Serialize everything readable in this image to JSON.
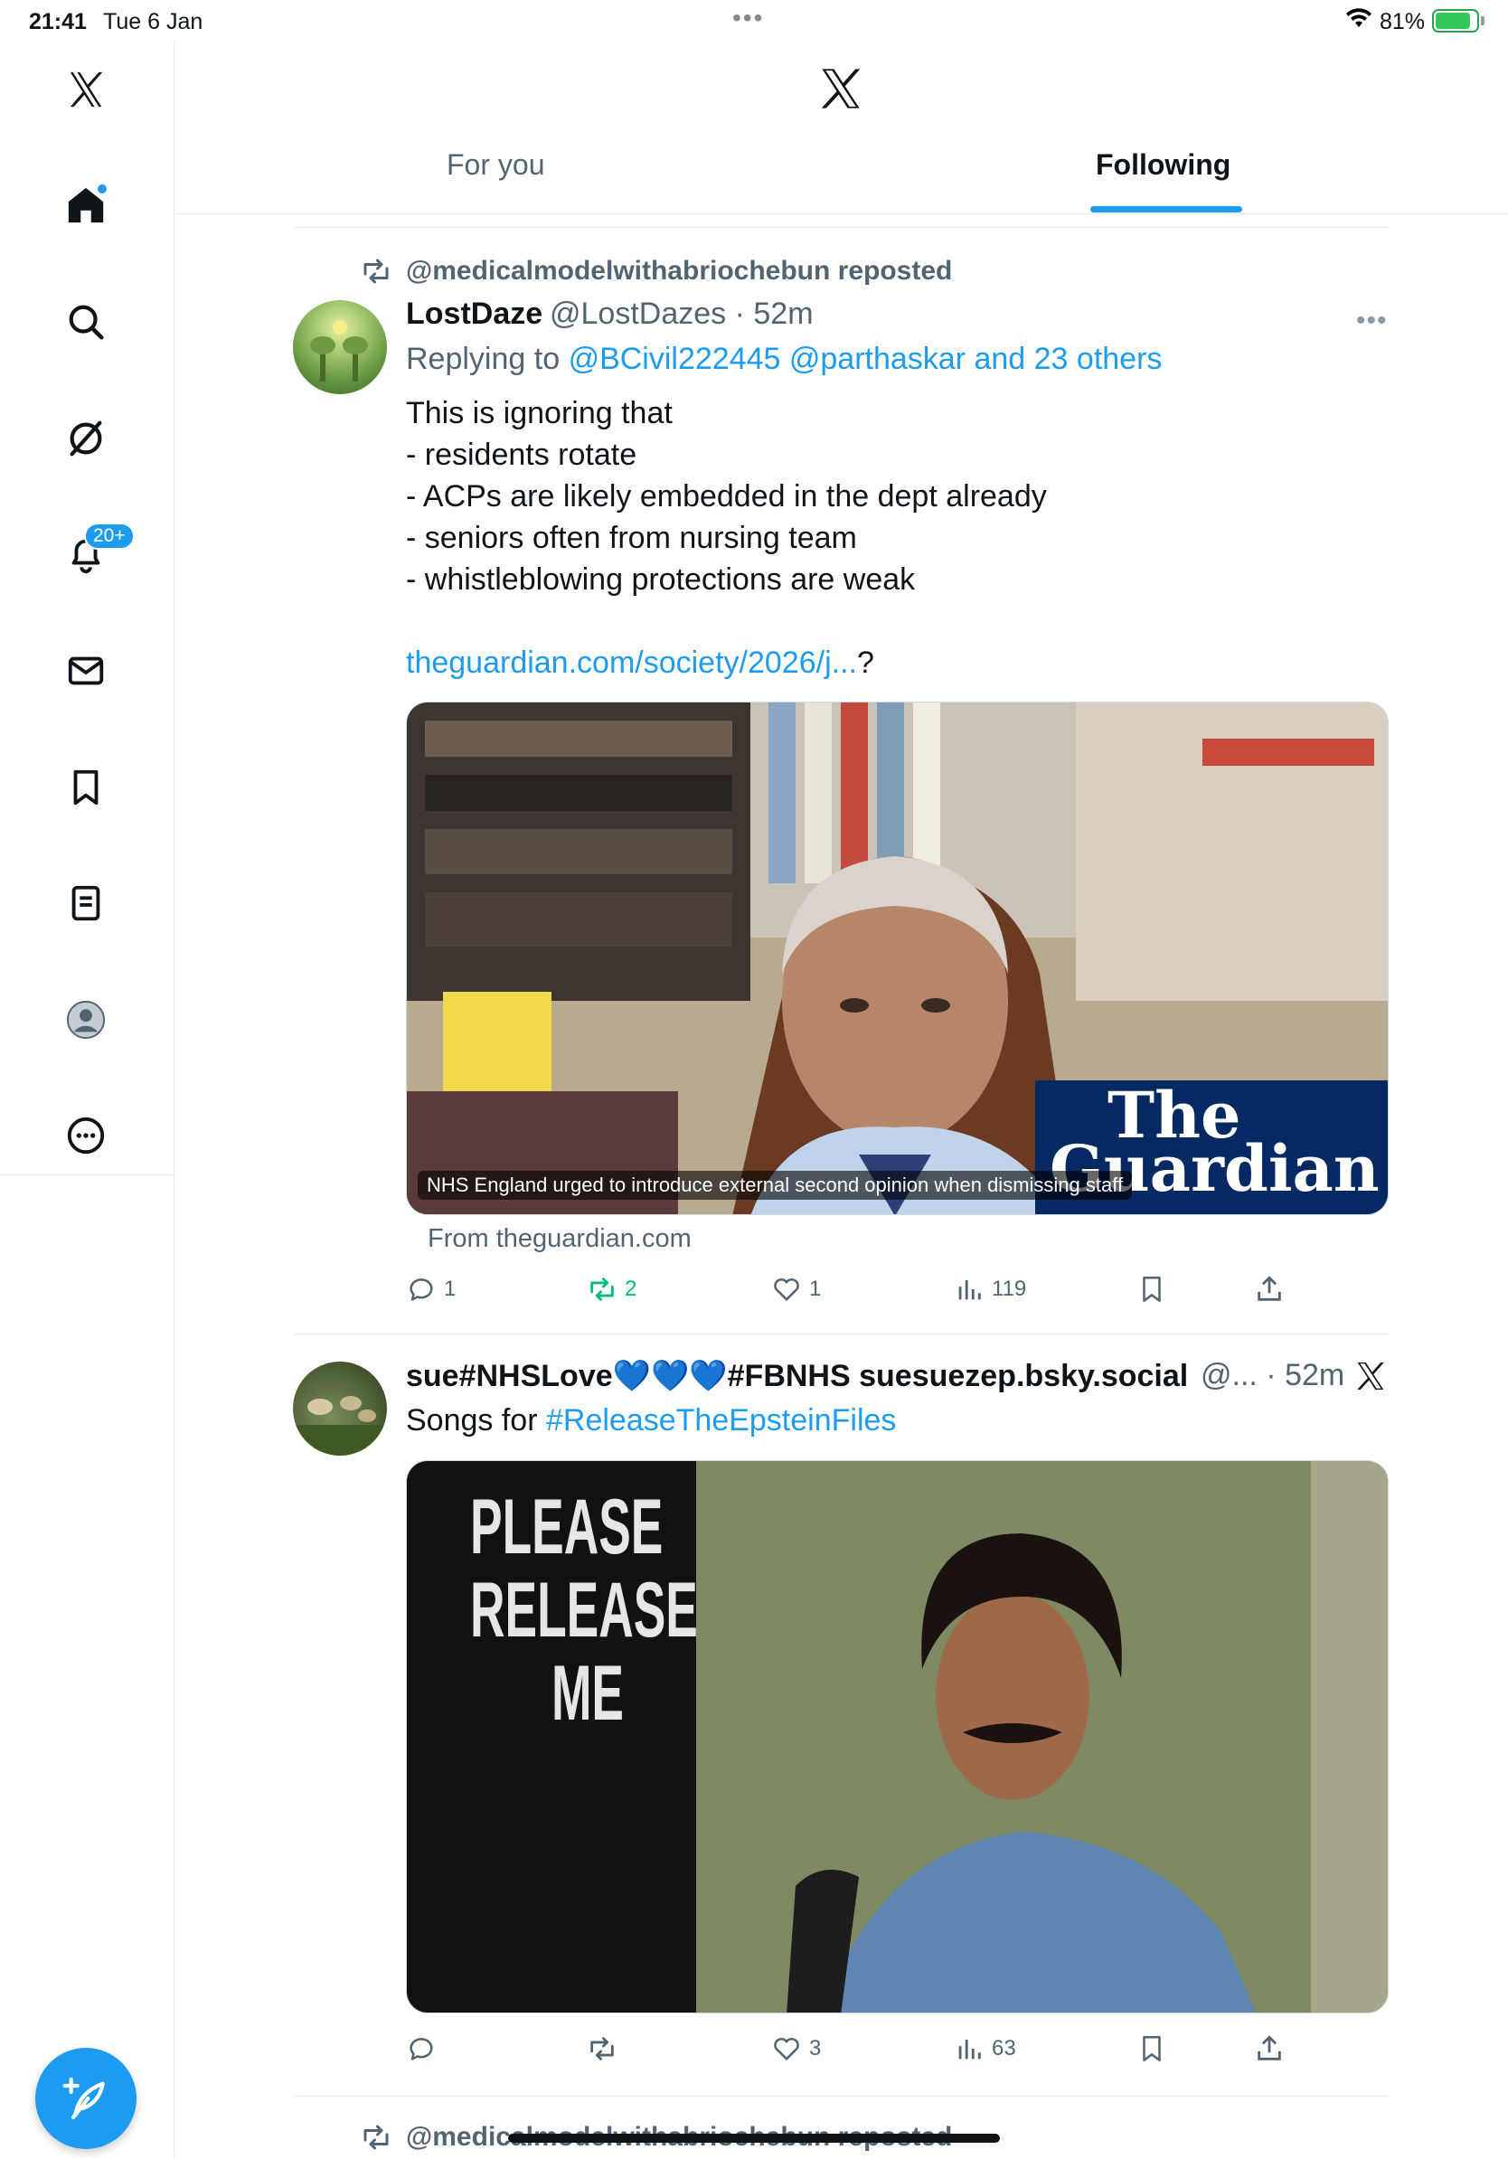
{
  "status_bar": {
    "time": "21:41",
    "date": "Tue 6 Jan",
    "battery": "81%"
  },
  "sidebar": {
    "items": [
      {
        "name": "x-logo"
      },
      {
        "name": "home"
      },
      {
        "name": "search"
      },
      {
        "name": "grok"
      },
      {
        "name": "notifications",
        "badge": "20+"
      },
      {
        "name": "messages"
      },
      {
        "name": "bookmarks"
      },
      {
        "name": "lists"
      },
      {
        "name": "profile"
      },
      {
        "name": "more"
      }
    ]
  },
  "header": {
    "tabs": [
      {
        "label": "For you"
      },
      {
        "label": "Following"
      }
    ],
    "active_tab": "Following"
  },
  "tweets": [
    {
      "repost_by": "@medicalmodelwithabriochebun reposted",
      "display_name": "LostDaze",
      "handle": "@LostDazes",
      "time": "52m",
      "replying_to_prefix": "Replying to",
      "replying_to": "@BCivil222445 @parthaskar and 23 others",
      "body": "This is ignoring that\n- residents rotate\n- ACPs are likely embedded in the dept already\n- seniors often from nursing team\n- whistleblowing protections are weak",
      "link": "theguardian.com/society/2026/j...",
      "link_suffix": "?",
      "card_caption": "NHS England urged to introduce external second opinion when dismissing staff",
      "card_brand_1": "The",
      "card_brand_2": "Guardian",
      "card_from": "From theguardian.com",
      "replies": "1",
      "reposts": "2",
      "likes": "1",
      "views": "119"
    },
    {
      "display_name": "sue#NHSLove💙💙💙#FBNHS suesuezep.bsky.social",
      "handle": "@...",
      "time": "52m",
      "text_prefix": "Songs for",
      "hashtag": "#ReleaseTheEpsteinFiles",
      "image_text_1": "PLEASE",
      "image_text_2": "RELEASE",
      "image_text_3": "ME",
      "replies": "",
      "reposts": "",
      "likes": "3",
      "views": "63"
    }
  ],
  "next_repost": "@medicalmodelwithabriochebun reposted",
  "colors": {
    "accent": "#1d9bf0",
    "repost_active": "#00ba7c",
    "text": "#0f1419",
    "muted": "#536471"
  }
}
